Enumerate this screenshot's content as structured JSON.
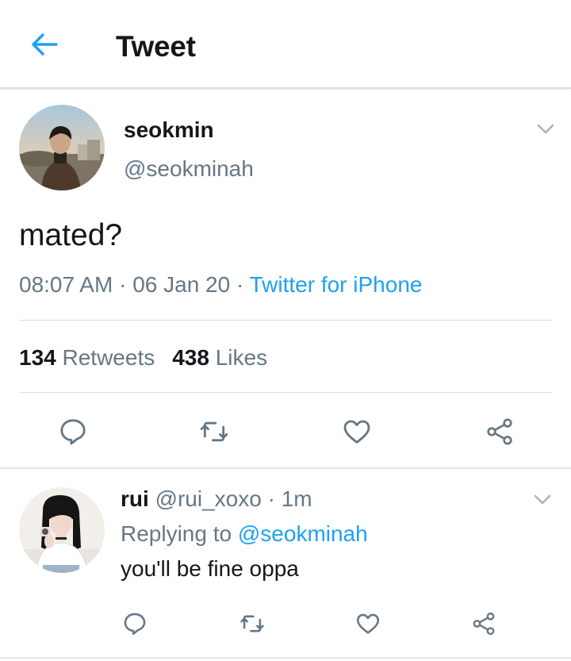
{
  "header": {
    "title": "Tweet",
    "back_icon": "arrow-left-icon",
    "accent": "#1da1f2"
  },
  "tweet": {
    "display_name": "seokmin",
    "handle": "@seokminah",
    "text": "mated?",
    "time": "08:07 AM",
    "date": "06 Jan 20",
    "source": "Twitter for iPhone",
    "separator": " · ",
    "retweets": "134",
    "retweets_label": "Retweets",
    "likes": "438",
    "likes_label": "Likes",
    "actions": [
      "reply-icon",
      "retweet-icon",
      "like-icon",
      "share-icon"
    ]
  },
  "reply": {
    "display_name": "rui",
    "handle": "@rui_xoxo",
    "separator": " · ",
    "time": "1m",
    "replying_prefix": "Replying to",
    "replying_to": "@seokminah",
    "text": "you'll be fine oppa",
    "actions": [
      "reply-icon",
      "retweet-icon",
      "like-icon",
      "share-icon"
    ]
  },
  "colors": {
    "text": "#14171a",
    "secondary": "#657786",
    "link": "#1da1f2",
    "divider": "#d9dde1"
  }
}
